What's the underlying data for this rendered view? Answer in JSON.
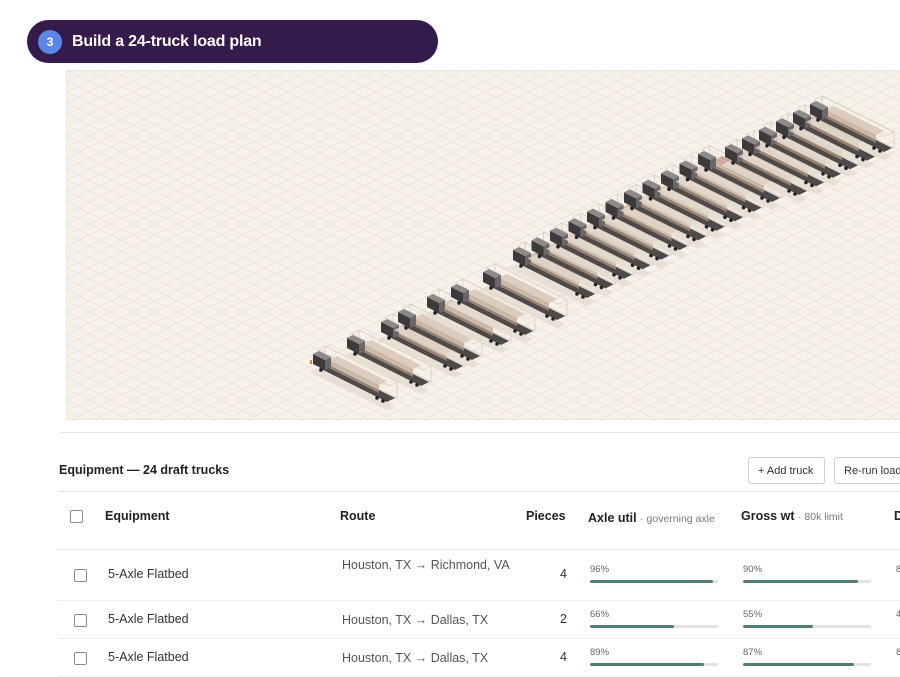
{
  "step": {
    "number": "3",
    "title": "Build a 24-truck load plan"
  },
  "section": {
    "title": "Equipment — 24 draft trucks",
    "add_truck_label": "+ Add truck",
    "rerun_label": "Re-run load"
  },
  "table": {
    "headers": {
      "equipment": "Equipment",
      "route": "Route",
      "pieces": "Pieces",
      "axle": "Axle util",
      "axle_sub": "· governing axle",
      "gross": "Gross wt",
      "gross_sub": "· 80k limit",
      "next": "D"
    },
    "rows": [
      {
        "equipment": "5-Axle Flatbed",
        "route": "Houston, TX → Richmond, VA",
        "pieces": "4",
        "axle_pct": "96%",
        "axle_val": 0.96,
        "gross_pct": "90%",
        "gross_val": 0.9,
        "next_trunc": "8"
      },
      {
        "equipment": "5-Axle Flatbed",
        "route": "Houston, TX → Dallas, TX",
        "pieces": "2",
        "axle_pct": "66%",
        "axle_val": 0.66,
        "gross_pct": "55%",
        "gross_val": 0.55,
        "next_trunc": "4"
      },
      {
        "equipment": "5-Axle Flatbed",
        "route": "Houston, TX → Dallas, TX",
        "pieces": "4",
        "axle_pct": "89%",
        "axle_val": 0.89,
        "gross_pct": "87%",
        "gross_val": 0.87,
        "next_trunc": "8"
      }
    ]
  },
  "colors": {
    "pill_bg": "#351a4c",
    "step_badge": "#5a86e6",
    "bar_fill": "#4d7f6e",
    "viz_bg": "#f6f1ea"
  }
}
